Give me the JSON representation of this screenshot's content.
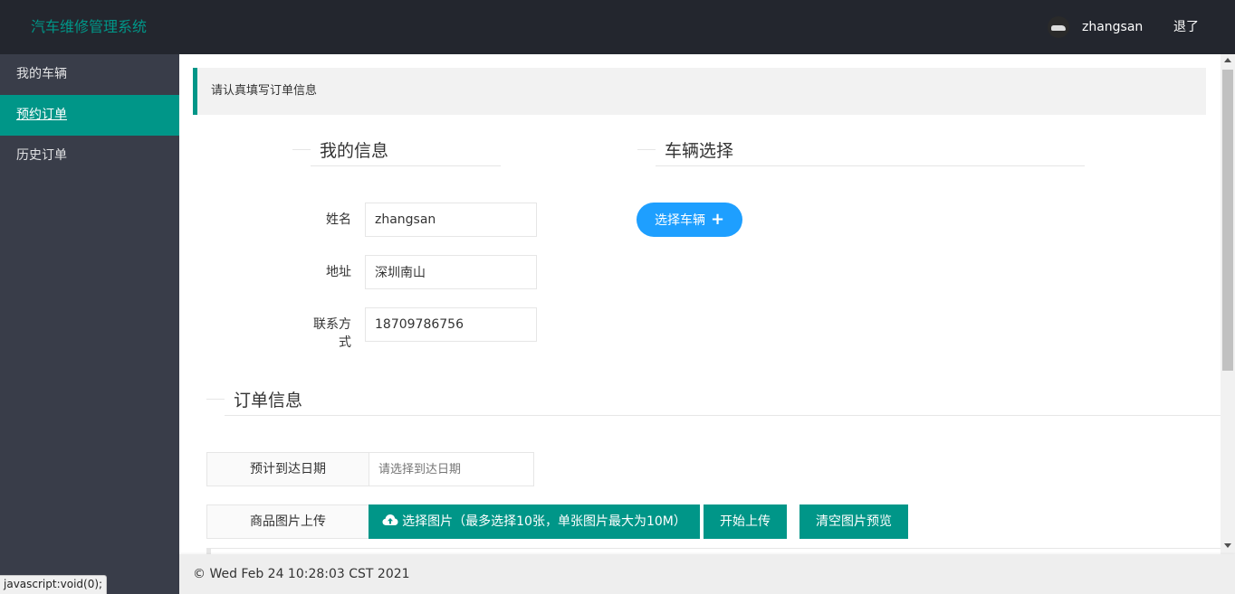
{
  "header": {
    "logo": "汽车维修管理系统",
    "username": "zhangsan",
    "logout": "退了"
  },
  "sidebar": {
    "items": [
      {
        "label": "我的车辆",
        "active": false
      },
      {
        "label": "预约订单",
        "active": true
      },
      {
        "label": "历史订单",
        "active": false
      }
    ]
  },
  "notice": "请认真填写订单信息",
  "my_info": {
    "title": "我的信息",
    "name_label": "姓名",
    "name_value": "zhangsan",
    "address_label": "地址",
    "address_value": "深圳南山",
    "contact_label": "联系方式",
    "contact_value": "18709786756"
  },
  "vehicle": {
    "title": "车辆选择",
    "select_button": "选择车辆",
    "select_icon": "plus-icon"
  },
  "order_info": {
    "title": "订单信息",
    "date_label": "预计到达日期",
    "date_placeholder": "请选择到达日期",
    "upload_label": "商品图片上传",
    "choose_button": "选择图片（最多选择10张，单张图片最大为10M）",
    "choose_icon": "cloud-upload-icon",
    "upload_button": "开始上传",
    "clear_button": "清空图片预览"
  },
  "footer": "© Wed Feb 24 10:28:03 CST 2021",
  "statusbar": "javascript:void(0);",
  "colors": {
    "header_bg": "#23262e",
    "sidebar_bg": "#393d49",
    "accent": "#009688",
    "blue": "#1e9fff"
  }
}
